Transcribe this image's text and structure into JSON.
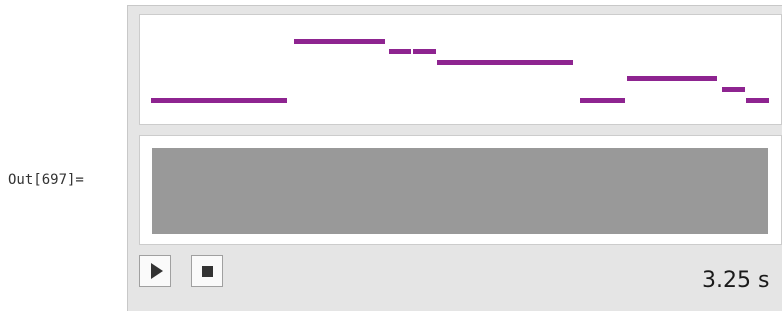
{
  "cell": {
    "out_label": "Out[697]="
  },
  "player": {
    "duration_text": "3.25 s",
    "note_color": "#8e2490",
    "waveform_color": "#999999",
    "play_icon": "play-icon",
    "stop_icon": "stop-icon"
  }
}
